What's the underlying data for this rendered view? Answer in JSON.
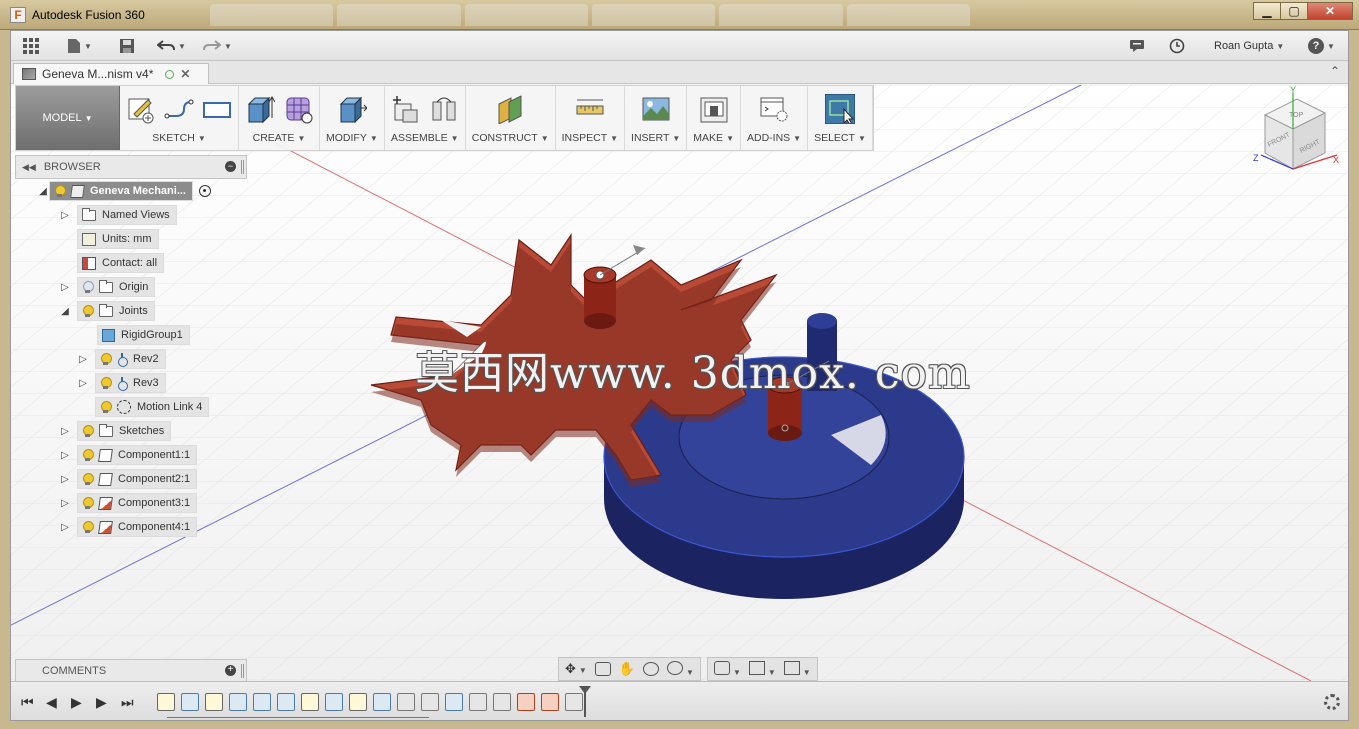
{
  "window": {
    "app_title": "Autodesk Fusion 360",
    "controls": {
      "minimize": "▁",
      "maximize": "▢",
      "close": "✕"
    }
  },
  "quick_access": {
    "user_name": "Roan Gupta",
    "help_label": "?"
  },
  "document_tab": {
    "title": "Geneva M...nism v4*"
  },
  "workspace": {
    "label": "MODEL"
  },
  "toolbar": {
    "groups": [
      {
        "label": "SKETCH"
      },
      {
        "label": "CREATE"
      },
      {
        "label": "MODIFY"
      },
      {
        "label": "ASSEMBLE"
      },
      {
        "label": "CONSTRUCT"
      },
      {
        "label": "INSPECT"
      },
      {
        "label": "INSERT"
      },
      {
        "label": "MAKE"
      },
      {
        "label": "ADD-INS"
      },
      {
        "label": "SELECT"
      }
    ]
  },
  "browser": {
    "title": "BROWSER",
    "items": [
      {
        "label": "Geneva Mechani...",
        "icon": "component-icon"
      },
      {
        "label": "Named Views",
        "icon": "folder-icon"
      },
      {
        "label": "Units: mm",
        "icon": "units-icon"
      },
      {
        "label": "Contact: all",
        "icon": "contact-icon"
      },
      {
        "label": "Origin",
        "icon": "folder-icon"
      },
      {
        "label": "Joints",
        "icon": "folder-icon"
      },
      {
        "label": "RigidGroup1",
        "icon": "rigid-group-icon"
      },
      {
        "label": "Rev2",
        "icon": "revolute-joint-icon"
      },
      {
        "label": "Rev3",
        "icon": "revolute-joint-icon"
      },
      {
        "label": "Motion Link 4",
        "icon": "motion-link-icon"
      },
      {
        "label": "Sketches",
        "icon": "folder-icon"
      },
      {
        "label": "Component1:1",
        "icon": "component-icon"
      },
      {
        "label": "Component2:1",
        "icon": "component-icon"
      },
      {
        "label": "Component3:1",
        "icon": "component-icon"
      },
      {
        "label": "Component4:1",
        "icon": "component-icon"
      }
    ]
  },
  "comments": {
    "title": "COMMENTS"
  },
  "viewcube": {
    "top": "TOP",
    "front": "FRONT",
    "right": "RIGHT",
    "axis_x": "X",
    "axis_y": "Y",
    "axis_z": "Z"
  },
  "watermark": {
    "text": "莫西网www. 3dmox. com"
  },
  "colors": {
    "geneva_wheel": "#b84a36",
    "drive_disc": "#2c3a8c",
    "shaft": "#8c2418",
    "accent_select": "#3d7aa8"
  }
}
